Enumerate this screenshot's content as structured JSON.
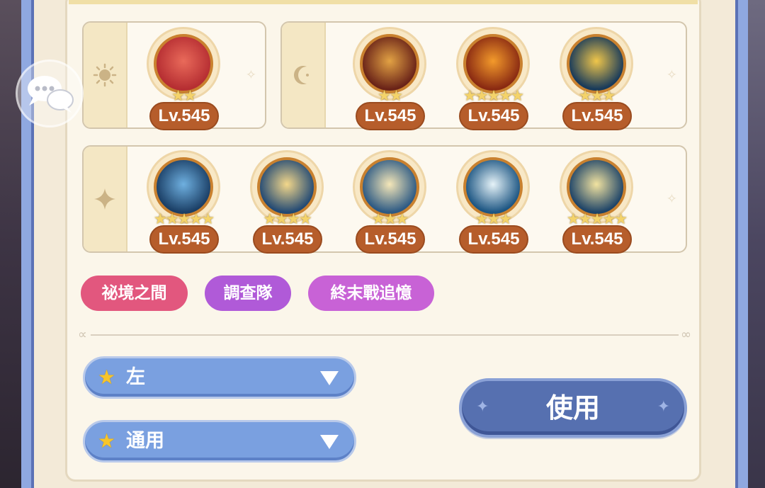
{
  "groups": {
    "sun": {
      "element_icon": "sun-icon",
      "units": [
        {
          "stars": 2,
          "level": "Lv.545",
          "orb": "crimson-moon-icon",
          "colors": [
            "#b62e32",
            "#e96a5a"
          ]
        }
      ]
    },
    "moon": {
      "element_icon": "crescent-icon",
      "units": [
        {
          "stars": 2,
          "level": "Lv.545",
          "orb": "tornado-icon",
          "colors": [
            "#6a2318",
            "#e2a244"
          ]
        },
        {
          "stars": 5,
          "level": "Lv.545",
          "orb": "flame-crest-icon",
          "colors": [
            "#8a2a12",
            "#f39a2b"
          ]
        },
        {
          "stars": 3,
          "level": "Lv.545",
          "orb": "golden-figure-icon",
          "colors": [
            "#183a5a",
            "#f0c64a"
          ]
        }
      ]
    },
    "star": {
      "element_icon": "four-point-star-icon",
      "units": [
        {
          "stars": 5,
          "level": "Lv.545",
          "orb": "wind-wings-icon",
          "colors": [
            "#1b3f66",
            "#6fb0e0"
          ]
        },
        {
          "stars": 4,
          "level": "Lv.545",
          "orb": "vortex-icon",
          "colors": [
            "#234a74",
            "#f3d78a"
          ]
        },
        {
          "stars": 3,
          "level": "Lv.545",
          "orb": "pale-beast-icon",
          "colors": [
            "#2d5a84",
            "#f5e7b8"
          ]
        },
        {
          "stars": 3,
          "level": "Lv.545",
          "orb": "leaping-beast-icon",
          "colors": [
            "#1d5683",
            "#e6f3f8"
          ]
        },
        {
          "stars": 5,
          "level": "Lv.545",
          "orb": "spiral-galaxy-icon",
          "colors": [
            "#1e4468",
            "#f2e3a0"
          ]
        }
      ]
    }
  },
  "tags": [
    {
      "label": "祕境之間",
      "color": "#e2577e"
    },
    {
      "label": "調查隊",
      "color": "#b05ad8"
    },
    {
      "label": "終末戰追憶",
      "color": "#c862d6"
    }
  ],
  "dropdowns": {
    "position": {
      "value": "左"
    },
    "mode": {
      "value": "通用"
    }
  },
  "use_button": {
    "label": "使用"
  },
  "colors": {
    "accent": "#5670b0",
    "level_badge": "#b65d2b",
    "star": "#f7c52a"
  }
}
